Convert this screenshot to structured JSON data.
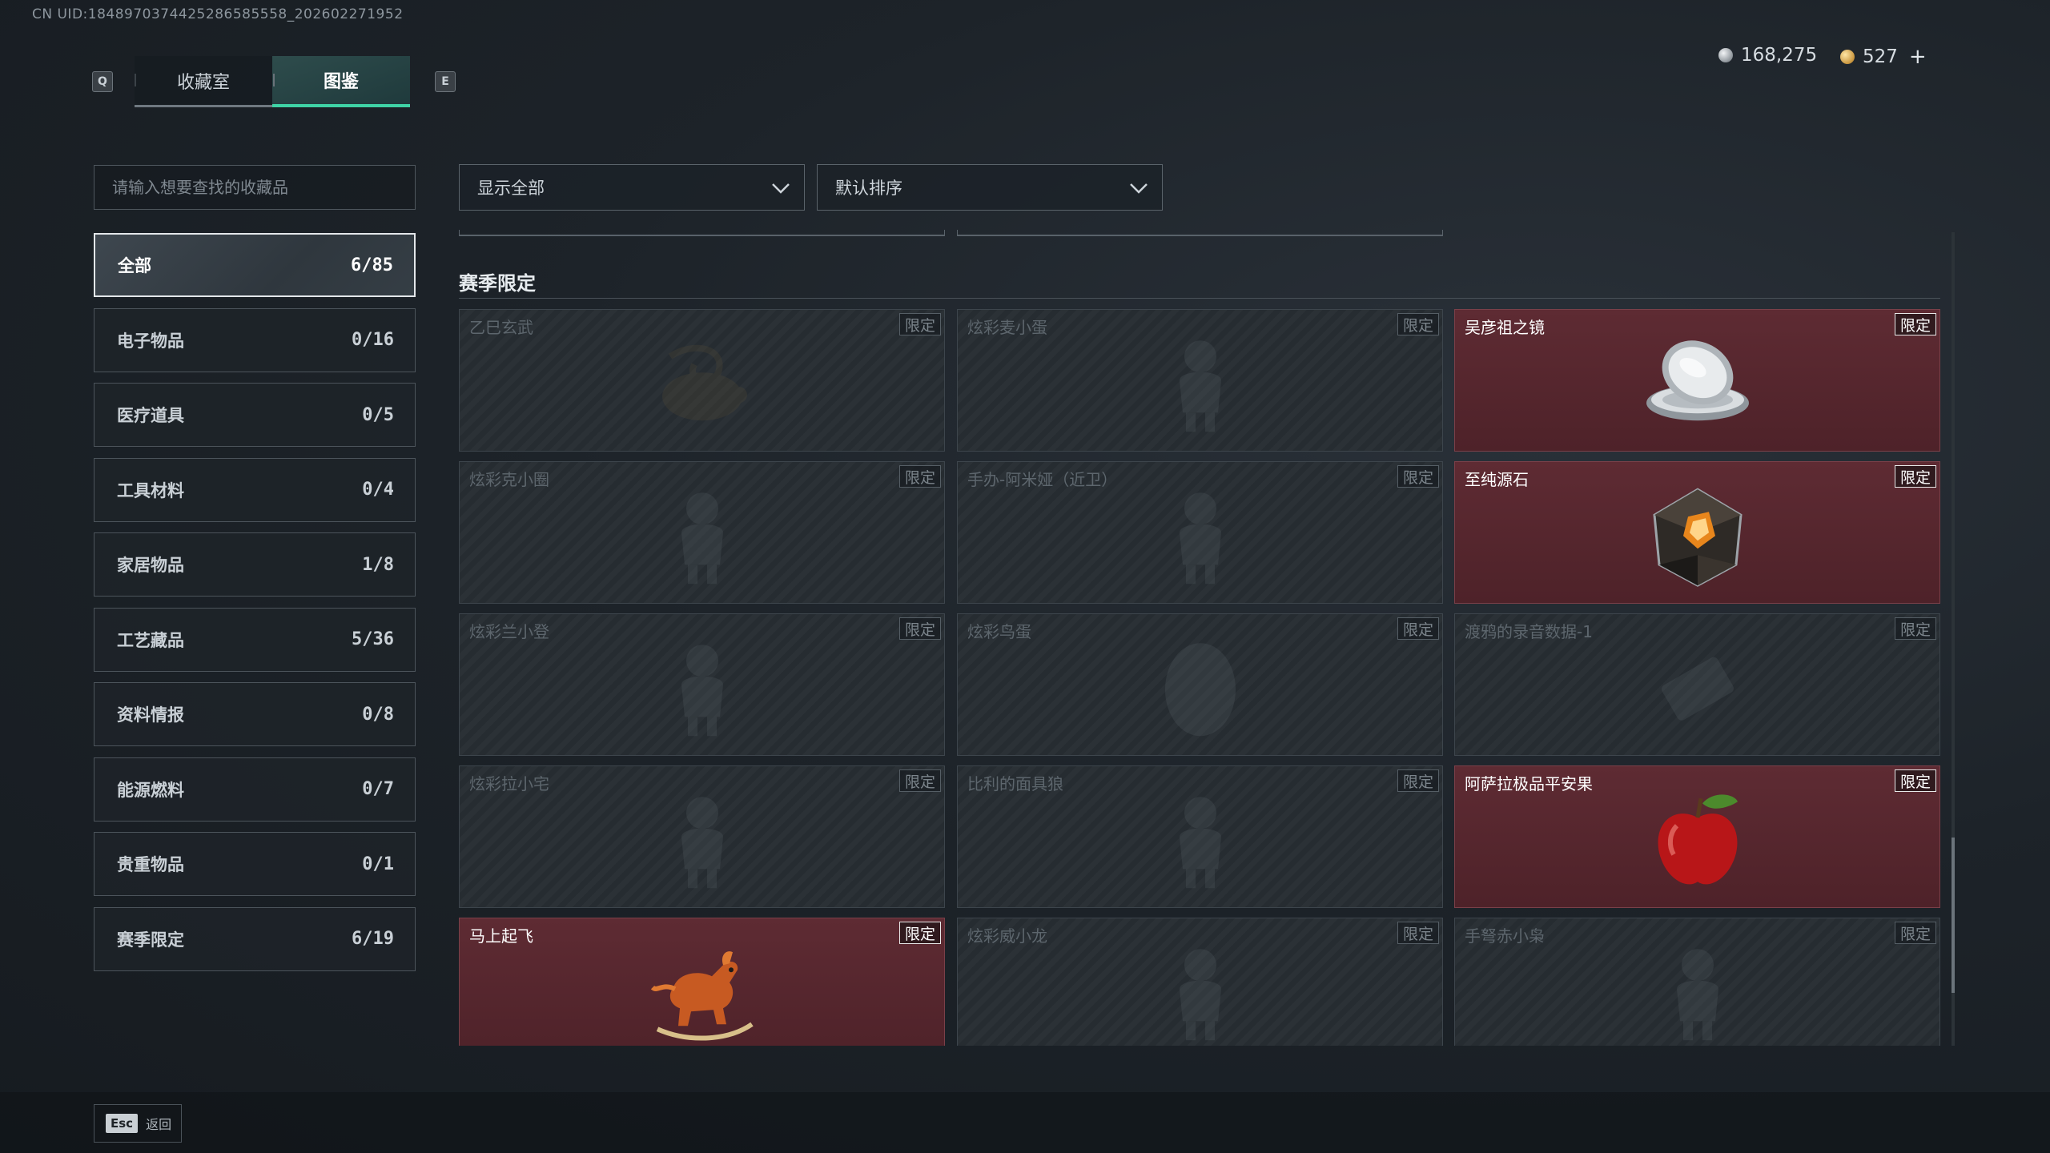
{
  "uid": "CN UID:1848970374425286585558_202602271952",
  "keys": {
    "left": "Q",
    "right": "E"
  },
  "tabs": [
    {
      "label": "收藏室",
      "active": false
    },
    {
      "label": "图鉴",
      "active": true
    }
  ],
  "currency": {
    "silver": "168,275",
    "gold": "527",
    "plus": "+"
  },
  "search": {
    "placeholder": "请输入想要查找的收藏品"
  },
  "filters": {
    "show": "显示全部",
    "sort": "默认排序"
  },
  "categories": [
    {
      "label": "全部",
      "count": "6/85",
      "active": true
    },
    {
      "label": "电子物品",
      "count": "0/16"
    },
    {
      "label": "医疗道具",
      "count": "0/5"
    },
    {
      "label": "工具材料",
      "count": "0/4"
    },
    {
      "label": "家居物品",
      "count": "1/8"
    },
    {
      "label": "工艺藏品",
      "count": "5/36"
    },
    {
      "label": "资料情报",
      "count": "0/8"
    },
    {
      "label": "能源燃料",
      "count": "0/7"
    },
    {
      "label": "贵重物品",
      "count": "0/1"
    },
    {
      "label": "赛季限定",
      "count": "6/19"
    }
  ],
  "section": {
    "title": "赛季限定"
  },
  "items": [
    {
      "name": "乙巳玄武",
      "tag": "限定",
      "owned": false,
      "icon": "serpent-turtle-icon"
    },
    {
      "name": "炫彩麦小蛋",
      "tag": "限定",
      "owned": false,
      "icon": "figure-icon"
    },
    {
      "name": "吴彦祖之镜",
      "tag": "限定",
      "owned": true,
      "icon": "compact-mirror-icon"
    },
    {
      "name": "炫彩克小圈",
      "tag": "限定",
      "owned": false,
      "icon": "figure-icon"
    },
    {
      "name": "手办-阿米娅（近卫）",
      "tag": "限定",
      "owned": false,
      "icon": "figure-icon"
    },
    {
      "name": "至纯源石",
      "tag": "限定",
      "owned": true,
      "icon": "crystal-icon"
    },
    {
      "name": "炫彩兰小登",
      "tag": "限定",
      "owned": false,
      "icon": "figure-icon"
    },
    {
      "name": "炫彩鸟蛋",
      "tag": "限定",
      "owned": false,
      "icon": "egg-icon"
    },
    {
      "name": "渡鸦的录音数据-1",
      "tag": "限定",
      "owned": false,
      "icon": "data-drive-icon"
    },
    {
      "name": "炫彩拉小宅",
      "tag": "限定",
      "owned": false,
      "icon": "figure-icon"
    },
    {
      "name": "比利的面具狼",
      "tag": "限定",
      "owned": false,
      "icon": "figure-icon"
    },
    {
      "name": "阿萨拉极品平安果",
      "tag": "限定",
      "owned": true,
      "icon": "apple-icon"
    },
    {
      "name": "马上起飞",
      "tag": "限定",
      "owned": true,
      "icon": "rocking-horse-icon"
    },
    {
      "name": "炫彩威小龙",
      "tag": "限定",
      "owned": false,
      "icon": "figure-icon"
    },
    {
      "name": "手弩赤小枭",
      "tag": "限定",
      "owned": false,
      "icon": "figure-icon"
    }
  ],
  "footer": {
    "esc_key": "Esc",
    "esc_label": "返回"
  }
}
